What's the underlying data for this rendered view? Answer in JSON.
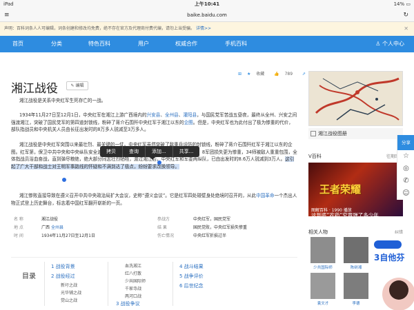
{
  "status": {
    "device": "iPad",
    "time": "上午10:41",
    "battery": "14%"
  },
  "url": {
    "address": "baike.baidu.com"
  },
  "notice": {
    "text": "声明：百科词条人人可编辑，词条创建和修改均免费，绝不存在官方及代理商付费代编，请勿上当受骗。",
    "link": "详情>>"
  },
  "nav": {
    "items": [
      "首页",
      "分类",
      "特色百科",
      "用户",
      "权威合作",
      "手机百科"
    ],
    "user": "个人中心"
  },
  "toolbar": {
    "collect": "收藏",
    "likes": "789",
    "shares": "59"
  },
  "article": {
    "title": "湘江战役",
    "edit": "编辑",
    "p1": "湘江战役是关系中央红军生死存亡的一战。",
    "p2a": "1934年11月27日至12月1日，中央红军在湘江上游广西境内的",
    "p2b": "兴安县",
    "p2c": "、",
    "p2d": "全州县",
    "p2e": "、",
    "p2f": "灌阳县",
    "p2g": "，与国民党军苦战五昼夜，最终从全州、兴安之间强渡湘江，突破了国民党军的第四道封锁线，粉碎了蒋介石围歼中央红军于湘江以东的",
    "p2h": "企图",
    "p2i": "。但是，中央红军也为此付出了极为惨重的代价，部队指战员和中央机关人员由长征出发时的8万多人锐减至3万多人。",
    "p3a": "湘江战役是中央红军突围以来最壮烈、最关键的一仗。中央红军虽然突破了敌重兵设防的封锁线，粉碎了蒋介石围歼红军于湘江以东的企图。红军第",
    "p3b": "，保卫中共中央和中央纵队安全渡江，但是在长征前夕成立的少共国际师损失过半，8军团损失更为惨重，34师被敌人重重包围，全体指战员浴血奋战，直到弹尽粮绝，绝大部分同志壮烈牺牲，渡过湘江后，中央红军和军委两纵队，已由出发时的8.6万人锐减到3万人。",
    "p3c": "这引起了广大干部和战士对王明军事路线的怀疑和不满到达了极点，纷纷要求改换领导。",
    "p4a": "湘江惨败直接导致在遵义召开中共中央政治局扩大会议，史称“遵义会议”。它是红军四处碰壁身处绝境时召开的，从此",
    "p4b": "中国革命",
    "p4c": "一个杰出人物正式登上历史舞台，标志着中国红军翻开崭新的一页。"
  },
  "context_menu": [
    "拷贝",
    "查询",
    "添加...",
    "共享..."
  ],
  "infobox": {
    "rows": [
      {
        "k1": "名  称",
        "v1": "湘江战役",
        "k2": "参战方",
        "v2": "中央红军，国民党军"
      },
      {
        "k1": "地  点",
        "v1": "广西",
        "v1b": "全州县",
        "k2": "结  果",
        "v2": "国民党败，中央红军损失惨重"
      },
      {
        "k1": "时  间",
        "v1": "1934年11月27日至12月1日",
        "k2": "伤亡情况",
        "v2": "中央红军折损过半"
      }
    ]
  },
  "toc": {
    "label": "目录",
    "col1": [
      "1  战役背景",
      "2  战役经过"
    ],
    "col1_sub": [
      "新圩之战",
      "光华铺之战",
      "觉山之战"
    ],
    "col2_sub": [
      "血洗湘江",
      "红八打散",
      "少共国际师",
      "千家寺战",
      "两河口战"
    ],
    "col2_tail": "3  战役争议",
    "col3": [
      "4  战斗结果",
      "5  战争评价",
      "6  后世纪念"
    ]
  },
  "sidebar": {
    "map_caption": "湘江战役图册",
    "v_title": "V百科",
    "v_more": "往期回顾",
    "video_game": "王者荣耀",
    "video_cap1": "图解百科 · 1990 播放",
    "video_cap2": "这到底“农药”究竟弹了多少年",
    "related_title": "相关人物",
    "related_more": "纠错",
    "people": [
      "少共国际师",
      "陈树湘",
      "",
      "袁文才",
      "李德",
      ""
    ]
  },
  "share": {
    "label": "分享"
  },
  "ad": {
    "line1": "3自他芬"
  }
}
